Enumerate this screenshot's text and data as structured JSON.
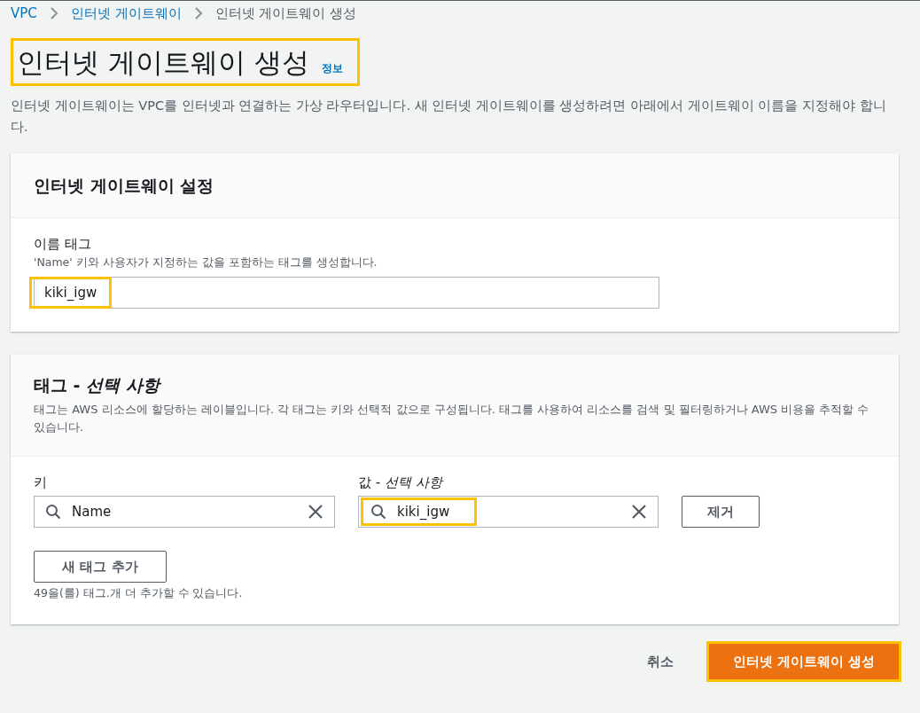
{
  "breadcrumbs": [
    {
      "label": "VPC",
      "kind": "link"
    },
    {
      "label": "인터넷 게이트웨이",
      "kind": "link"
    },
    {
      "label": "인터넷 게이트웨이 생성",
      "kind": "current"
    }
  ],
  "header": {
    "title": "인터넷 게이트웨이 생성",
    "info_link": "정보",
    "highlighted": true,
    "description": "인터넷 게이트웨이는 VPC를 인터넷과 연결하는 가상 라우터입니다. 새 인터넷 게이트웨이를 생성하려면 아래에서 게이트웨이 이름을 지정해야 합니다."
  },
  "settings_card": {
    "title": "인터넷 게이트웨이 설정",
    "name_tag": {
      "label": "이름 태그",
      "hint": "'Name' 키와 사용자가 지정하는 값을 포함하는 태그를 생성합니다.",
      "value": "kiki_igw",
      "highlighted": true
    }
  },
  "tags_card": {
    "title": "태그 - ",
    "title_optional": "선택 사항",
    "description": "태그는 AWS 리소스에 할당하는 레이블입니다. 각 태그는 키와 선택적 값으로 구성됩니다. 태그를 사용하여 리소스를 검색 및 필터링하거나 AWS 비용을 추적할 수 있습니다.",
    "key_label": "키",
    "value_label": "값 - ",
    "value_label_optional": "선택 사항",
    "rows": [
      {
        "key": "Name",
        "value": "kiki_igw",
        "value_highlighted": true,
        "remove": "제거"
      }
    ],
    "add_button": "새 태그 추가",
    "limit_note": "49을(를) 태그.개 더 추가할 수 있습니다."
  },
  "actions": {
    "cancel": "취소",
    "create": "인터넷 게이트웨이 생성",
    "create_highlighted": true
  }
}
